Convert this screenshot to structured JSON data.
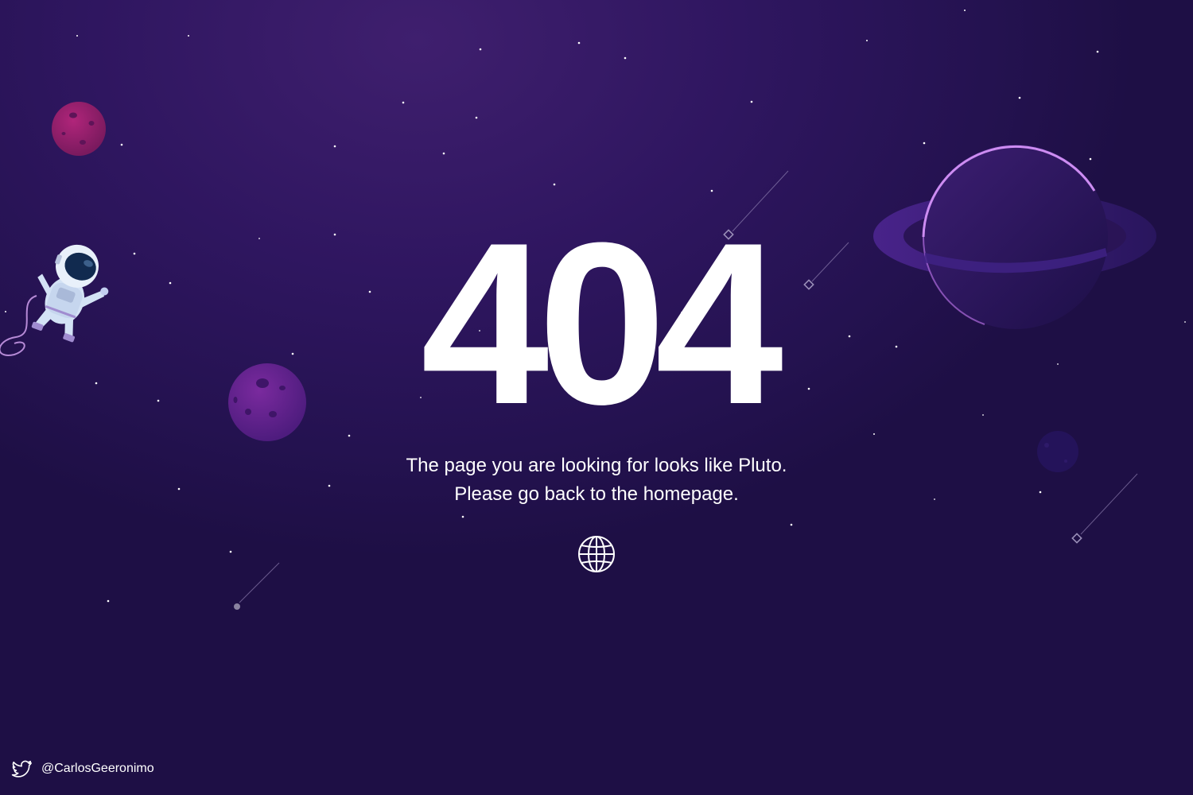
{
  "error_code": "404",
  "message": {
    "line1": "The page you are looking for looks like Pluto.",
    "line2": "Please go back to the homepage."
  },
  "home_link": {
    "icon": "globe-icon"
  },
  "footer": {
    "icon": "twitter-icon",
    "handle": "@CarlosGeeronimo"
  },
  "colors": {
    "background": "#2a1458",
    "accent_purple": "#b979f0",
    "text": "#ffffff"
  }
}
